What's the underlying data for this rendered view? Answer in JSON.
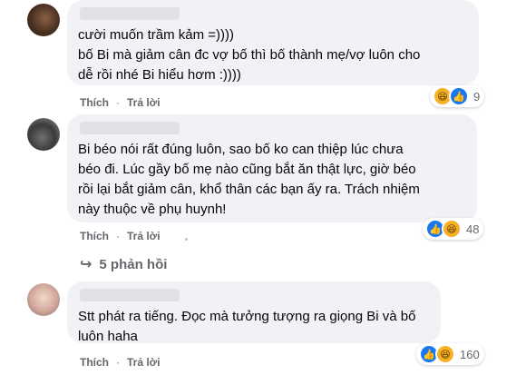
{
  "comments": [
    {
      "text": "cười muốn trầm kảm =))))\nbố Bi mà giảm cân đc vợ bố thì bố thành mẹ/vợ luôn cho\ndễ rồi nhé Bi hiểu hơm :))))",
      "like_label": "Thích",
      "reply_label": "Trả lời",
      "reaction_icons": [
        "haha-icon",
        "like-icon"
      ],
      "reaction_count": "9"
    },
    {
      "text": "Bi béo nói rất đúng luôn, sao bố ko can thiệp lúc chưa\nbéo đi. Lúc gầy bố mẹ nào cũng bắt ăn thật lực, giờ béo\nrồi lại bắt giảm cân, khổ thân các bạn ấy ra. Trách nhiệm\nnày thuộc về phụ huynh!",
      "like_label": "Thích",
      "reply_label": "Trả lời",
      "reaction_icons": [
        "like-icon",
        "haha-icon"
      ],
      "reaction_count": "48"
    },
    {
      "text": "Stt phát ra tiếng. Đọc mà tưởng tượng ra giọng Bi và bố\nluôn haha",
      "like_label": "Thích",
      "reply_label": "Trả lời",
      "reaction_icons": [
        "like-icon",
        "haha-icon"
      ],
      "reaction_count": "160"
    }
  ],
  "replies_label": "5 phản hồi",
  "colors": {
    "bubble": "#f0f2f5",
    "like_blue": "#1877f2",
    "haha_yellow": "#f7b125",
    "meta_gray": "#65676b"
  }
}
